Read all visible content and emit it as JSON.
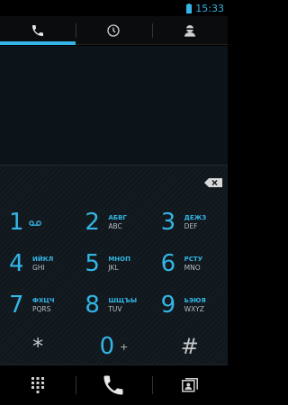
{
  "status_bar": {
    "time": "15:33",
    "battery_icon": "battery-icon"
  },
  "tabs": [
    {
      "icon": "phone-icon",
      "active": true
    },
    {
      "icon": "clock-icon",
      "active": false
    },
    {
      "icon": "contact-icon",
      "active": false
    }
  ],
  "dialpad": {
    "delete_icon": "backspace-icon",
    "keys": [
      {
        "digit": "1",
        "ru": "",
        "en": "",
        "icon": "voicemail-icon"
      },
      {
        "digit": "2",
        "ru": "АБВГ",
        "en": "ABC"
      },
      {
        "digit": "3",
        "ru": "ДЕЖЗ",
        "en": "DEF"
      },
      {
        "digit": "4",
        "ru": "ИЙКЛ",
        "en": "GHI"
      },
      {
        "digit": "5",
        "ru": "МНОП",
        "en": "JKL"
      },
      {
        "digit": "6",
        "ru": "РСТУ",
        "en": "MNO"
      },
      {
        "digit": "7",
        "ru": "ФХЦЧ",
        "en": "PQRS"
      },
      {
        "digit": "8",
        "ru": "ШЩЪЫ",
        "en": "TUV"
      },
      {
        "digit": "9",
        "ru": "ЬЭЮЯ",
        "en": "WXYZ"
      },
      {
        "symbol": "*"
      },
      {
        "digit": "0",
        "plus": "+"
      },
      {
        "symbol": "#"
      }
    ]
  },
  "bottom_bar": {
    "left_icon": "dialpad-grid-icon",
    "center_icon": "call-icon",
    "right_icon": "contacts-card-icon"
  },
  "colors": {
    "accent": "#33b5e5",
    "background": "#000000",
    "display_bg": "#0c141a"
  }
}
